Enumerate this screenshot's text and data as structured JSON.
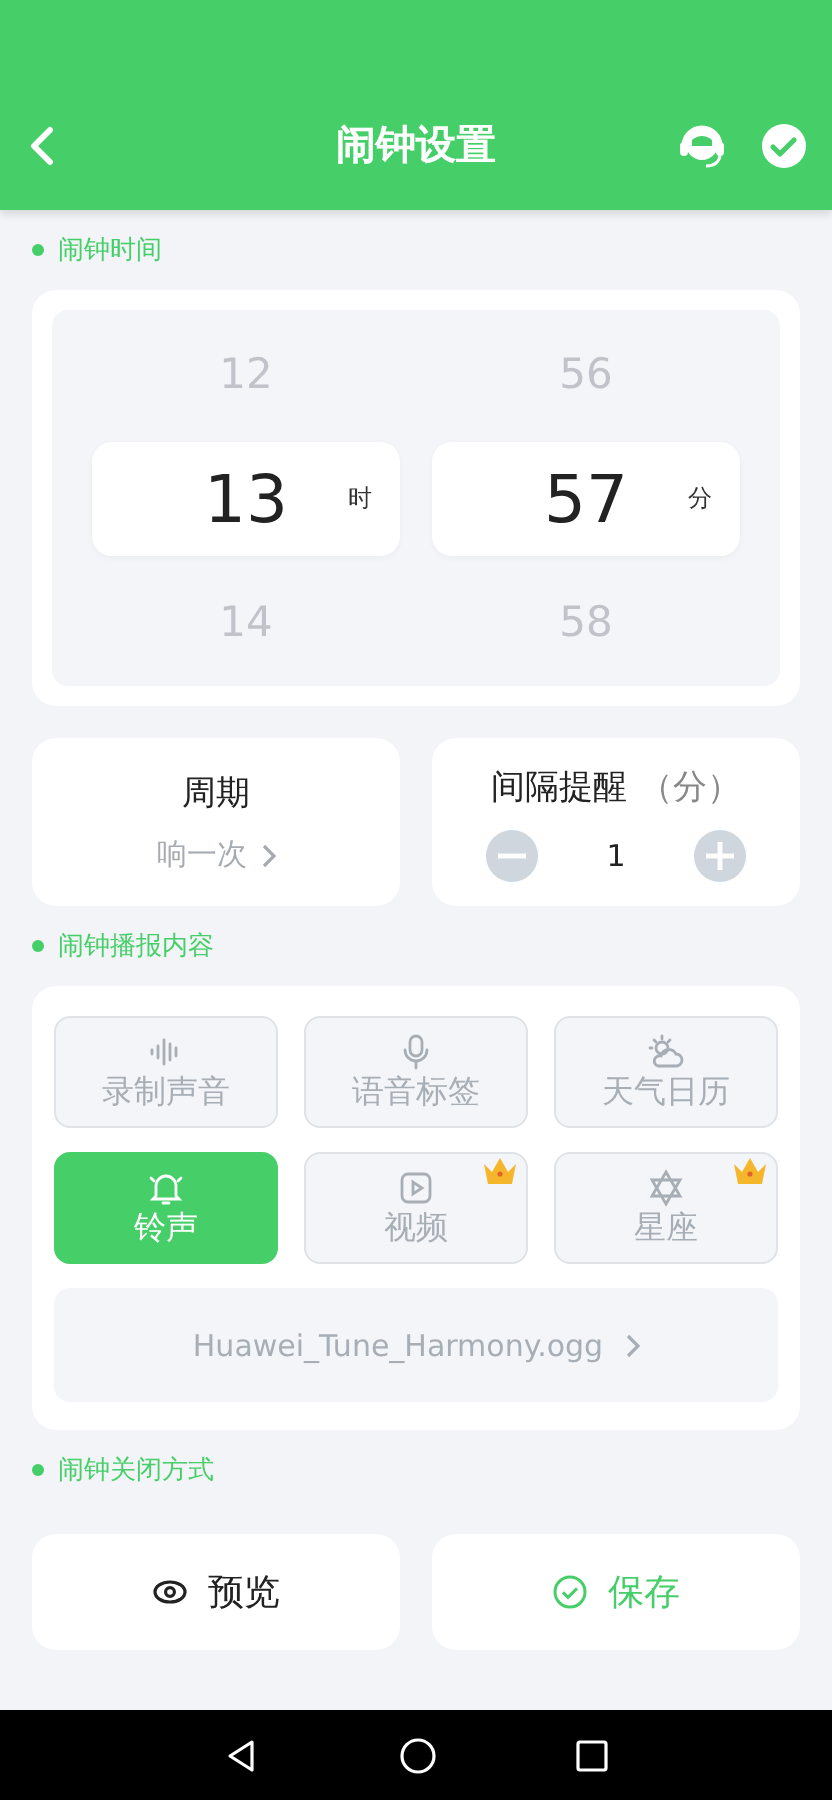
{
  "header": {
    "title": "闹钟设置"
  },
  "sections": [
    {
      "label": "闹钟时间"
    },
    {
      "label": "闹钟播报内容"
    },
    {
      "label": "闹钟关闭方式"
    }
  ],
  "time_picker": {
    "columns": [
      {
        "above": "12",
        "value": "13",
        "unit": "时",
        "below": "14"
      },
      {
        "above": "56",
        "value": "57",
        "unit": "分",
        "below": "58"
      }
    ]
  },
  "cycle": {
    "title": "周期",
    "value": "响一次"
  },
  "interval": {
    "title": "间隔提醒",
    "unit": "（分）",
    "value": "1"
  },
  "content_options": [
    {
      "kind": "record",
      "label": "录制声音",
      "selected": false,
      "premium": false
    },
    {
      "kind": "voice",
      "label": "语音标签",
      "selected": false,
      "premium": false
    },
    {
      "kind": "weather",
      "label": "天气日历",
      "selected": false,
      "premium": false
    },
    {
      "kind": "ring",
      "label": "铃声",
      "selected": true,
      "premium": false
    },
    {
      "kind": "video",
      "label": "视频",
      "selected": false,
      "premium": true
    },
    {
      "kind": "star",
      "label": "星座",
      "selected": false,
      "premium": true
    }
  ],
  "ringtone": {
    "file": "Huawei_Tune_Harmony.ogg"
  },
  "actions": [
    {
      "kind": "preview",
      "label": "预览"
    },
    {
      "kind": "save",
      "label": "保存"
    }
  ]
}
